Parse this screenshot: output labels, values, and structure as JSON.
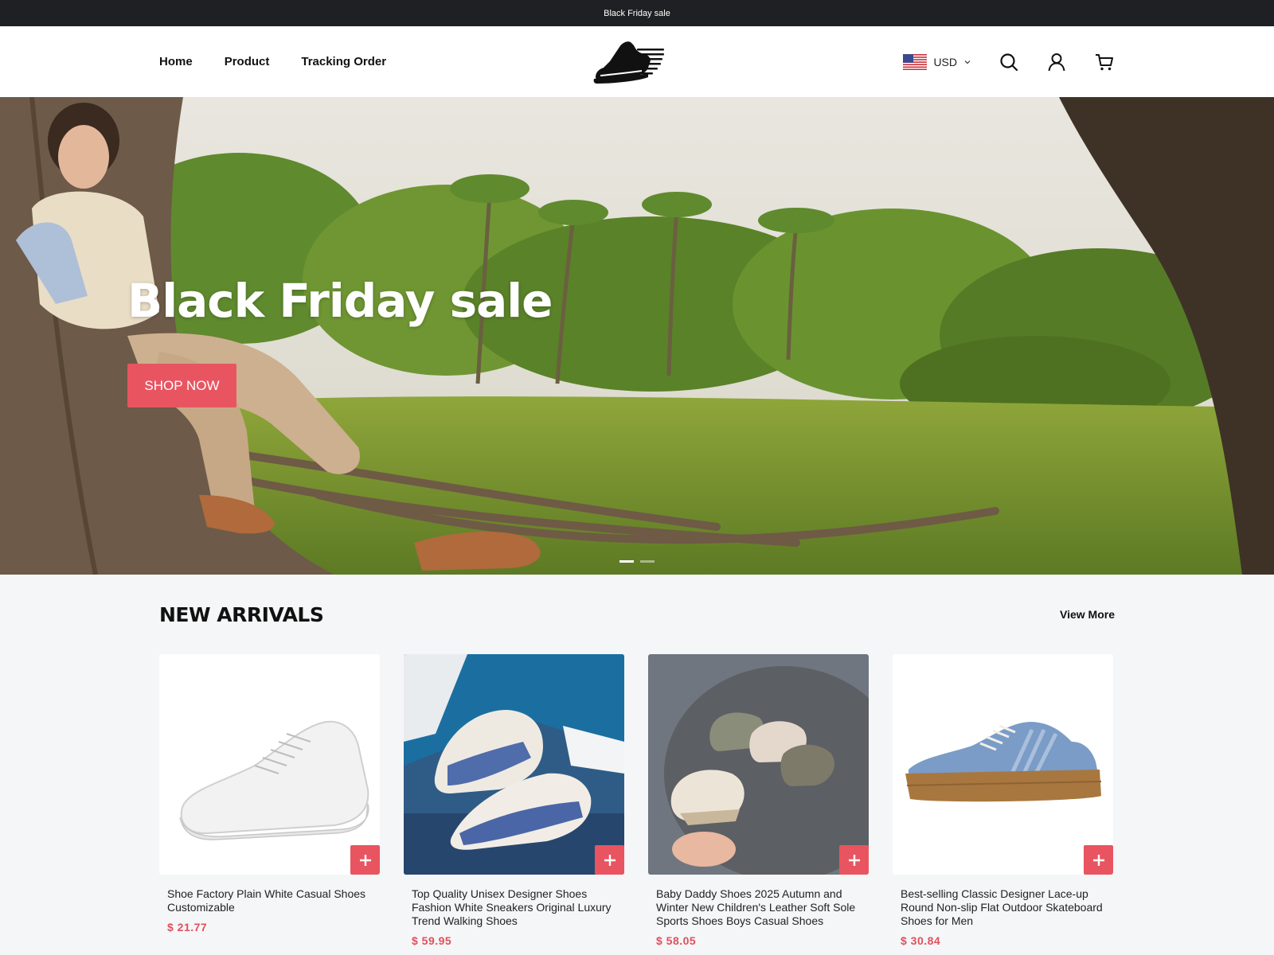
{
  "announcement": "Black Friday sale",
  "nav": {
    "items": [
      {
        "label": "Home"
      },
      {
        "label": "Product"
      },
      {
        "label": "Tracking Order"
      }
    ]
  },
  "header": {
    "logo_icon": "running-shoe-logo",
    "currency": "USD",
    "icons": [
      "search-icon",
      "account-icon",
      "cart-icon"
    ]
  },
  "hero": {
    "title": "Black Friday sale",
    "cta": "SHOP NOW",
    "slide_count": 2,
    "active_slide": 1
  },
  "new_arrivals": {
    "heading": "NEW ARRIVALS",
    "view_more": "View More",
    "products": [
      {
        "title": "Shoe Factory Plain White Casual Shoes Customizable",
        "price": "$ 21.77"
      },
      {
        "title": "Top Quality Unisex Designer Shoes Fashion White Sneakers Original Luxury Trend Walking Shoes",
        "price": "$ 59.95"
      },
      {
        "title": "Baby Daddy Shoes 2025 Autumn and Winter New Children's Leather Soft Sole Sports Shoes Boys Casual Shoes",
        "price": "$ 58.05"
      },
      {
        "title": "Best-selling Classic Designer Lace-up Round Non-slip Flat Outdoor Skateboard Shoes for Men",
        "price": "$ 30.84"
      }
    ]
  },
  "colors": {
    "accent": "#e85560",
    "price": "#e0505b",
    "topbar": "#1f2023"
  }
}
